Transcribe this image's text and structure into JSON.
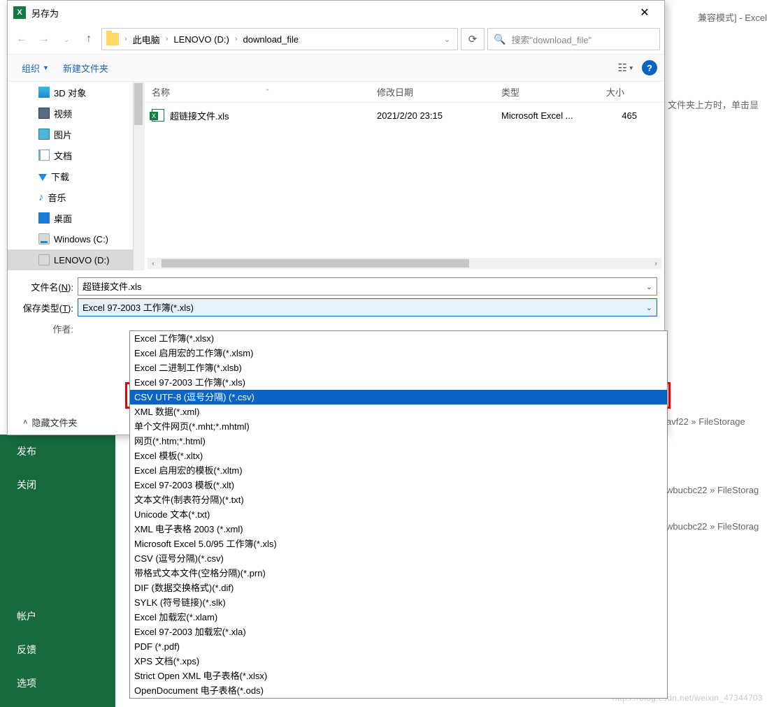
{
  "excel_bg": {
    "title_suffix": "兼容模式]  -  Excel",
    "hint_text": "文件夹上方时，单击显",
    "sidebar_items": [
      "发布",
      "关闭",
      "帐户",
      "反馈",
      "选项"
    ],
    "path_fragments": [
      "avf22 » FileStorage",
      "wbucbc22 » FileStorag",
      "wbucbc22 » FileStorag"
    ]
  },
  "dialog": {
    "title": "另存为",
    "breadcrumb": [
      "此电脑",
      "LENOVO (D:)",
      "download_file"
    ],
    "search_placeholder": "搜索\"download_file\"",
    "toolbar": {
      "organize": "组织",
      "new_folder": "新建文件夹"
    },
    "tree": [
      {
        "icon": "3d",
        "label": "3D 对象"
      },
      {
        "icon": "video",
        "label": "视频"
      },
      {
        "icon": "pic",
        "label": "图片"
      },
      {
        "icon": "doc",
        "label": "文档"
      },
      {
        "icon": "down",
        "label": "下载"
      },
      {
        "icon": "music",
        "label": "音乐"
      },
      {
        "icon": "desk",
        "label": "桌面"
      },
      {
        "icon": "drive-c",
        "label": "Windows (C:)"
      },
      {
        "icon": "drive",
        "label": "LENOVO (D:)",
        "selected": true,
        "expandable": true
      }
    ],
    "columns": {
      "name": "名称",
      "date": "修改日期",
      "type": "类型",
      "size": "大小"
    },
    "files": [
      {
        "name": "超链接文件.xls",
        "date": "2021/2/20 23:15",
        "type": "Microsoft Excel ...",
        "size": "465"
      }
    ],
    "filename_label": "文件名(N):",
    "filename_value": "超链接文件.xls",
    "savetype_label": "保存类型(T):",
    "savetype_value": "Excel 97-2003 工作簿(*.xls)",
    "author_label": "作者:",
    "hide_folders": "隐藏文件夹",
    "type_options": [
      "Excel 工作簿(*.xlsx)",
      "Excel 启用宏的工作簿(*.xlsm)",
      "Excel 二进制工作簿(*.xlsb)",
      "Excel 97-2003 工作簿(*.xls)",
      "CSV UTF-8 (逗号分隔) (*.csv)",
      "XML 数据(*.xml)",
      "单个文件网页(*.mht;*.mhtml)",
      "网页(*.htm;*.html)",
      "Excel 模板(*.xltx)",
      "Excel 启用宏的模板(*.xltm)",
      "Excel 97-2003 模板(*.xlt)",
      "文本文件(制表符分隔)(*.txt)",
      "Unicode 文本(*.txt)",
      "XML 电子表格 2003 (*.xml)",
      "Microsoft Excel 5.0/95 工作簿(*.xls)",
      "CSV (逗号分隔)(*.csv)",
      "带格式文本文件(空格分隔)(*.prn)",
      "DIF (数据交换格式)(*.dif)",
      "SYLK (符号链接)(*.slk)",
      "Excel 加载宏(*.xlam)",
      "Excel 97-2003 加载宏(*.xla)",
      "PDF (*.pdf)",
      "XPS 文档(*.xps)",
      "Strict Open XML 电子表格(*.xlsx)",
      "OpenDocument 电子表格(*.ods)"
    ],
    "highlighted_option_index": 4
  },
  "watermark": "https://blog.csdn.net/weixin_47344703"
}
